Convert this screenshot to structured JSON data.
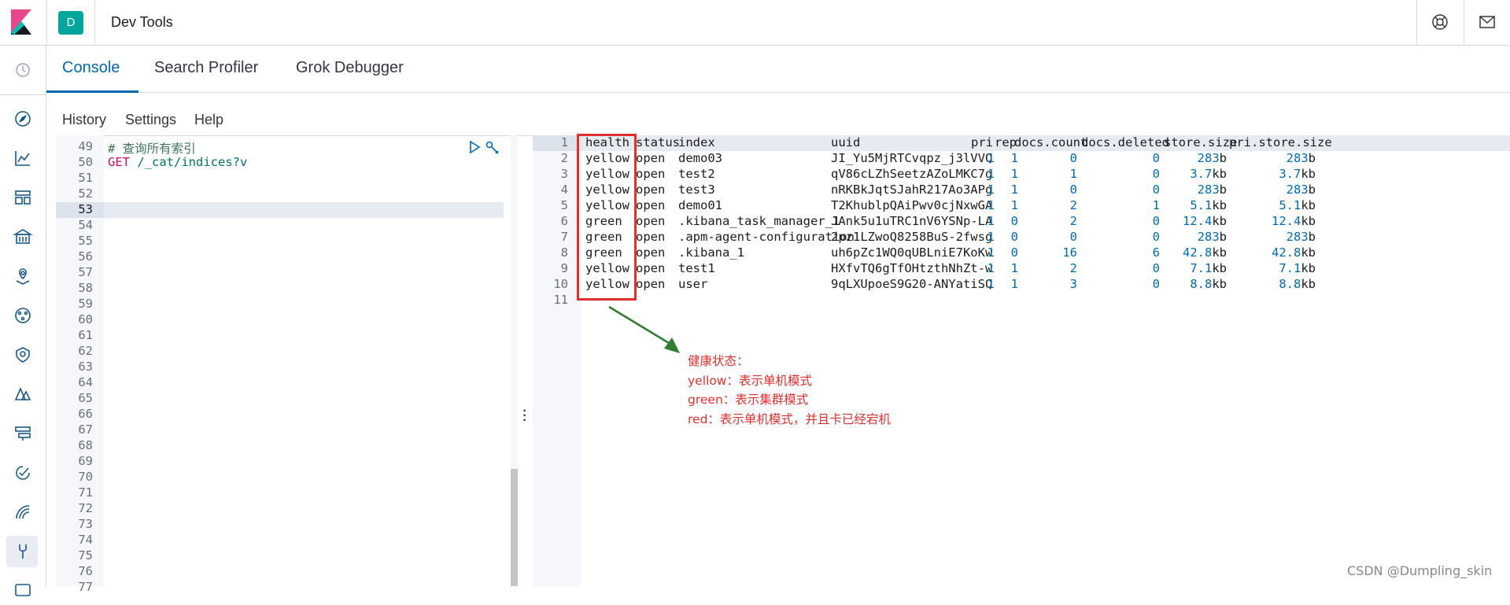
{
  "header": {
    "space_initial": "D",
    "app_title": "Dev Tools"
  },
  "tabs": [
    {
      "label": "Console",
      "active": true
    },
    {
      "label": "Search Profiler",
      "active": false
    },
    {
      "label": "Grok Debugger",
      "active": false
    }
  ],
  "menu": [
    "History",
    "Settings",
    "Help"
  ],
  "editor": {
    "line_numbers": [
      "49",
      "50",
      "51",
      "52",
      "53",
      "54",
      "55",
      "56",
      "57",
      "58",
      "59",
      "60",
      "61",
      "62",
      "63",
      "64",
      "65",
      "66",
      "67",
      "68",
      "69",
      "70",
      "71",
      "72",
      "73",
      "74",
      "75",
      "76",
      "77"
    ],
    "comment": "# 查询所有索引",
    "method": "GET",
    "url": "/_cat/indices?v"
  },
  "output": {
    "line_numbers": [
      "1",
      "2",
      "3",
      "4",
      "5",
      "6",
      "7",
      "8",
      "9",
      "10",
      "11"
    ],
    "columns": [
      "health",
      "status",
      "index",
      "uuid",
      "pri",
      "rep",
      "docs.count",
      "docs.deleted",
      "store.size",
      "pri.store.size"
    ],
    "rows": [
      [
        "yellow",
        "open",
        "demo03",
        "JI_Yu5MjRTCvqpz_j3lVVQ",
        "1",
        "1",
        "0",
        "0",
        "283b",
        "283b"
      ],
      [
        "yellow",
        "open",
        "test2",
        "qV86cLZhSeetzAZoLMKC7g",
        "1",
        "1",
        "1",
        "0",
        "3.7kb",
        "3.7kb"
      ],
      [
        "yellow",
        "open",
        "test3",
        "nRKBkJqtSJahR217Ao3APg",
        "1",
        "1",
        "0",
        "0",
        "283b",
        "283b"
      ],
      [
        "yellow",
        "open",
        "demo01",
        "T2KhublpQAiPwv0cjNxwGA",
        "1",
        "1",
        "2",
        "1",
        "5.1kb",
        "5.1kb"
      ],
      [
        "green",
        "open",
        ".kibana_task_manager_1",
        "JAnk5u1uTRC1nV6YSNp-LA",
        "1",
        "0",
        "2",
        "0",
        "12.4kb",
        "12.4kb"
      ],
      [
        "green",
        "open",
        ".apm-agent-configuration",
        "2pz1LZwoQ8258BuS-2fwsg",
        "1",
        "0",
        "0",
        "0",
        "283b",
        "283b"
      ],
      [
        "green",
        "open",
        ".kibana_1",
        "uh6pZc1WQ0qUBLniE7KoKw",
        "1",
        "0",
        "16",
        "6",
        "42.8kb",
        "42.8kb"
      ],
      [
        "yellow",
        "open",
        "test1",
        "HXfvTQ6gTfOHtzthNhZt-w",
        "1",
        "1",
        "2",
        "0",
        "7.1kb",
        "7.1kb"
      ],
      [
        "yellow",
        "open",
        "user",
        "9qLXUpoeS9G20-ANYatiSQ",
        "1",
        "1",
        "3",
        "0",
        "8.8kb",
        "8.8kb"
      ]
    ]
  },
  "annotation": {
    "lines": [
      "健康状态：",
      "yellow：表示单机模式",
      "green：表示集群模式",
      "red：表示单机模式，并且卡已经宕机"
    ]
  },
  "watermark": "CSDN @Dumpling_skin",
  "colors": {
    "accent": "#006bb4",
    "annotation": "#e0302e",
    "arrow": "#2e7d32",
    "space_badge": "#00a69b"
  }
}
